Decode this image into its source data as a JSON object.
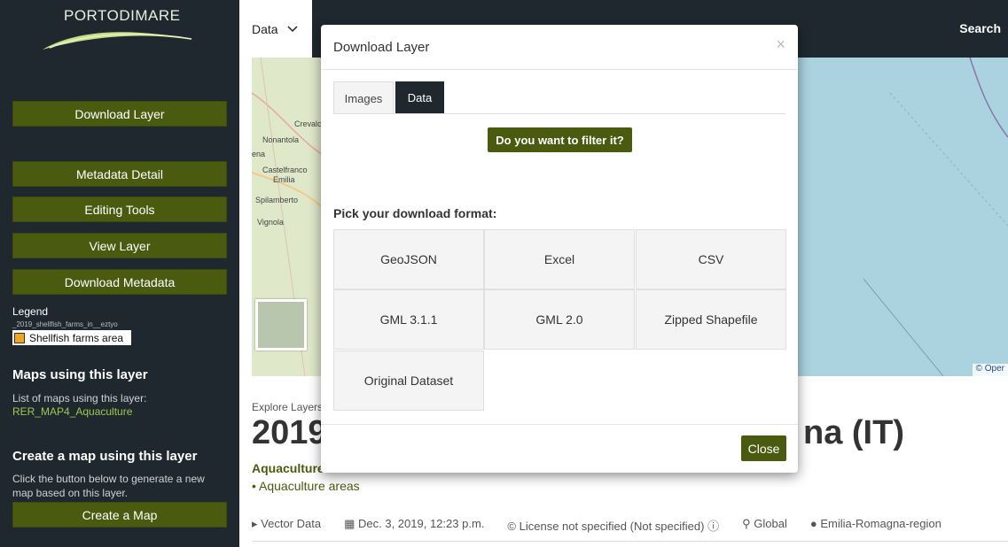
{
  "header": {
    "logo_text": "PORTODIMARE",
    "nav_data_label": "Data",
    "search_label": "Search"
  },
  "sidebar": {
    "buttons": {
      "download_layer": "Download Layer",
      "metadata_detail": "Metadata Detail",
      "editing_tools": "Editing Tools",
      "view_layer": "View Layer",
      "download_metadata": "Download Metadata",
      "create_map": "Create a Map"
    },
    "legend": {
      "title": "Legend",
      "layer_name": "_2019_shellfish_farms_in__eztyo",
      "item_label": "Shellfish farms area",
      "item_color": "#f2a41d"
    },
    "maps_using": {
      "heading": "Maps using this layer",
      "text": "List of maps using this layer:",
      "link": "RER_MAP4_Aquaculture"
    },
    "create_map": {
      "heading": "Create a map using this layer",
      "text": "Click the button below to generate a new map based on this layer."
    }
  },
  "map": {
    "labels": [
      "Crevalc",
      "Nonantola",
      "ena",
      "Castelfranco",
      "Emilia",
      "Spilamberto",
      "Vignola"
    ],
    "attribution": "© Oper"
  },
  "page": {
    "explore_prefix": "Explore Layers",
    "title_left": "2019",
    "title_right": "na (IT)",
    "category": "Aquaculture",
    "keyword": "• Aquaculture areas",
    "meta": {
      "type": "Vector Data",
      "date": "Dec. 3, 2019, 12:23 p.m.",
      "license": "License not specified (Not specified)",
      "region": "Global",
      "owner": "Emilia-Romagna-region"
    }
  },
  "modal": {
    "title": "Download Layer",
    "close_x": "×",
    "tabs": [
      "Images",
      "Data"
    ],
    "active_tab": "Data",
    "filter_button": "Do you want to filter it?",
    "pick_label": "Pick your download format:",
    "formats": [
      "GeoJSON",
      "Excel",
      "CSV",
      "GML 3.1.1",
      "GML 2.0",
      "Zipped Shapefile",
      "Original Dataset"
    ],
    "close_button": "Close"
  },
  "colors": {
    "accent": "#4a5a0f",
    "dark_bg": "#1f282f",
    "link": "#9bcb4e",
    "water": "#aad3df"
  }
}
